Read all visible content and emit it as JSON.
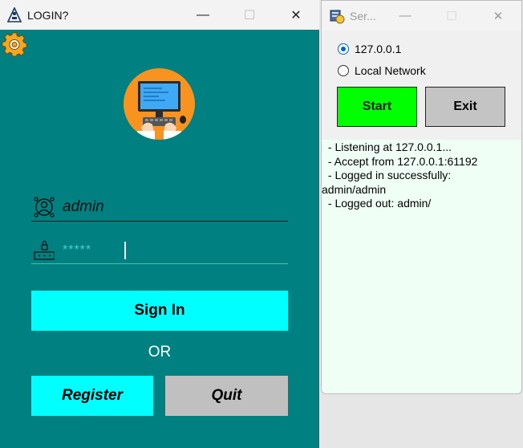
{
  "login_window": {
    "title": "LOGIN?",
    "controls": {
      "minimize": "—",
      "maximize": "☐",
      "close": "✕"
    },
    "username": "admin",
    "password_mask": "*****",
    "signin_label": "Sign In",
    "or_label": "OR",
    "register_label": "Register",
    "quit_label": "Quit"
  },
  "server_window": {
    "title": "Ser...",
    "controls": {
      "minimize": "—",
      "maximize": "☐",
      "close": "✕"
    },
    "options": [
      {
        "label": "127.0.0.1",
        "selected": true
      },
      {
        "label": "Local Network",
        "selected": false
      }
    ],
    "start_label": "Start",
    "exit_label": "Exit",
    "log": [
      " - Listening at 127.0.0.1...",
      " - Accept from 127.0.0.1:61192",
      " - Logged in successfully:",
      "admin/admin",
      " - Logged out: admin/"
    ]
  },
  "colors": {
    "login_bg": "#008080",
    "cyan_button": "#00ffff",
    "gray_button": "#c0c0c0",
    "start_green": "#00ff00",
    "log_bg": "#f0fff5",
    "avatar_orange": "#f7931e"
  },
  "icons": [
    "login-app-icon",
    "settings-gear-icon",
    "computer-user-avatar",
    "user-icon",
    "lock-icon",
    "server-app-icon"
  ]
}
